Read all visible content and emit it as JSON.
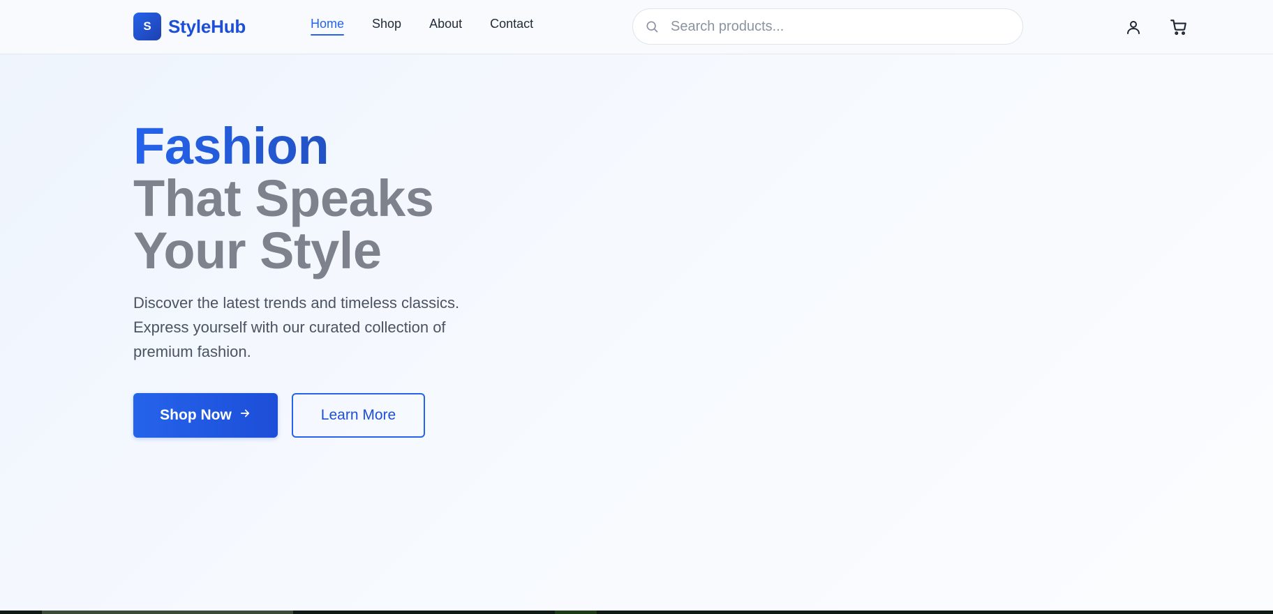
{
  "brand": {
    "logo_letter": "S",
    "name": "StyleHub"
  },
  "nav": {
    "items": [
      {
        "label": "Home",
        "active": true
      },
      {
        "label": "Shop",
        "active": false
      },
      {
        "label": "About",
        "active": false
      },
      {
        "label": "Contact",
        "active": false
      }
    ]
  },
  "search": {
    "placeholder": "Search products...",
    "value": ""
  },
  "header_icons": {
    "account": "user-icon",
    "cart": "cart-icon"
  },
  "hero": {
    "title_accent": "Fashion",
    "title_line2": "That Speaks",
    "title_line3": "Your Style",
    "description": "Discover the latest trends and timeless classics. Express yourself with our curated collection of premium fashion.",
    "primary_button": "Shop Now",
    "secondary_button": "Learn More"
  },
  "colors": {
    "accent": "#2563eb",
    "accent_dark": "#1d4ed8",
    "muted_heading": "#7d828d",
    "body_text": "#4b5260"
  }
}
